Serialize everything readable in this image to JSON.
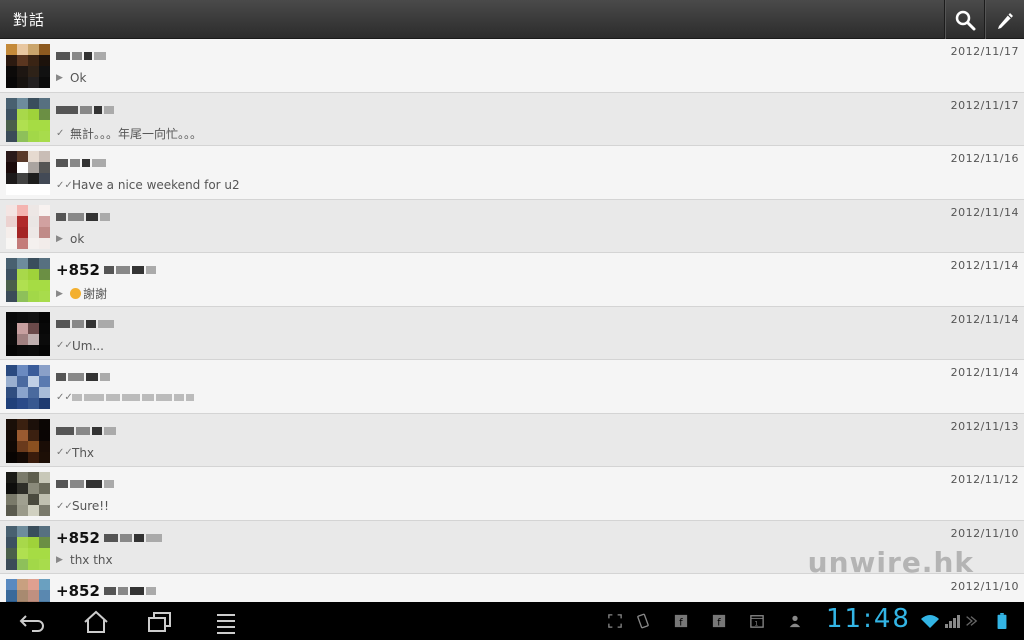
{
  "header": {
    "title": "對話"
  },
  "conversations": [
    {
      "name_prefix": "",
      "date": "2012/11/17",
      "preview": "Ok",
      "status": "arrow"
    },
    {
      "name_prefix": "",
      "date": "2012/11/17",
      "preview": "無計。。。年尾一向忙。。。",
      "status": "check"
    },
    {
      "name_prefix": "",
      "date": "2012/11/16",
      "preview": "Have a nice weekend for u2",
      "status": "double-check"
    },
    {
      "name_prefix": "",
      "date": "2012/11/14",
      "preview": "ok",
      "status": "arrow"
    },
    {
      "name_prefix": "+852",
      "date": "2012/11/14",
      "preview": "謝謝",
      "status": "arrow-emoji"
    },
    {
      "name_prefix": "",
      "date": "2012/11/14",
      "preview": "Um...",
      "status": "double-check"
    },
    {
      "name_prefix": "",
      "date": "2012/11/14",
      "preview": "",
      "status": "double-check"
    },
    {
      "name_prefix": "",
      "date": "2012/11/13",
      "preview": "Thx",
      "status": "double-check"
    },
    {
      "name_prefix": "",
      "date": "2012/11/12",
      "preview": "Sure!!",
      "status": "double-check"
    },
    {
      "name_prefix": "+852",
      "date": "2012/11/10",
      "preview": "thx thx",
      "status": "arrow"
    },
    {
      "name_prefix": "+852",
      "date": "2012/11/10",
      "preview": "",
      "status": "arrow"
    }
  ],
  "watermark": "unwire.hk",
  "system_bar": {
    "clock": "11:48"
  },
  "colors": {
    "accent": "#33b5e5",
    "topbar": "#3a3a3a"
  },
  "icons": {
    "search": "search-icon",
    "compose": "compose-icon",
    "back": "back-icon",
    "home": "home-icon",
    "recents": "recents-icon",
    "menu": "menu-icon"
  }
}
